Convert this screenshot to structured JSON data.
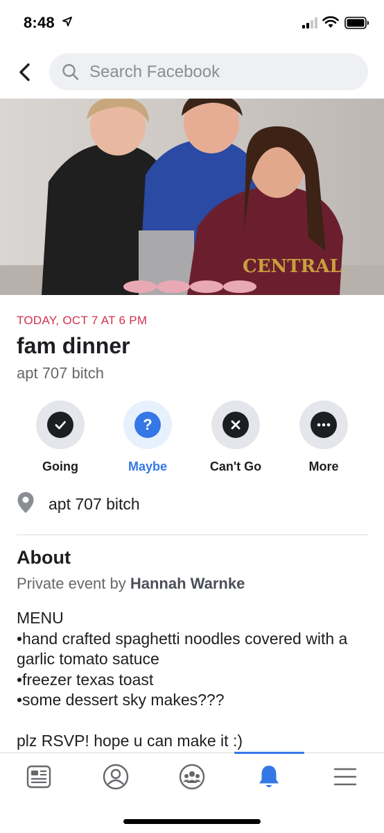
{
  "status_bar": {
    "time": "8:48"
  },
  "search": {
    "placeholder": "Search Facebook"
  },
  "event": {
    "date": "TODAY, OCT 7 AT 6 PM",
    "title": "fam dinner",
    "subtitle": "apt 707 bitch"
  },
  "rsvp": {
    "going": "Going",
    "maybe": "Maybe",
    "cant_go": "Can't Go",
    "more": "More",
    "selected": "maybe"
  },
  "location": {
    "text": "apt 707 bitch"
  },
  "about": {
    "title": "About",
    "host_prefix": "Private event by ",
    "host_name": "Hannah Warnke",
    "description": "MENU\n•hand crafted spaghetti noodles covered with a garlic tomato satuce\n•freezer texas toast\n•some dessert sky makes???\n\nplz RSVP! hope u can make it :)"
  },
  "tabs": {
    "items": [
      "news-feed",
      "profile",
      "groups",
      "notifications",
      "menu"
    ],
    "active": "notifications"
  },
  "colors": {
    "accent": "#3578e5",
    "date_red": "#d1304b",
    "chip_gray": "#e4e6eb",
    "search_bg": "#eff0f4"
  }
}
